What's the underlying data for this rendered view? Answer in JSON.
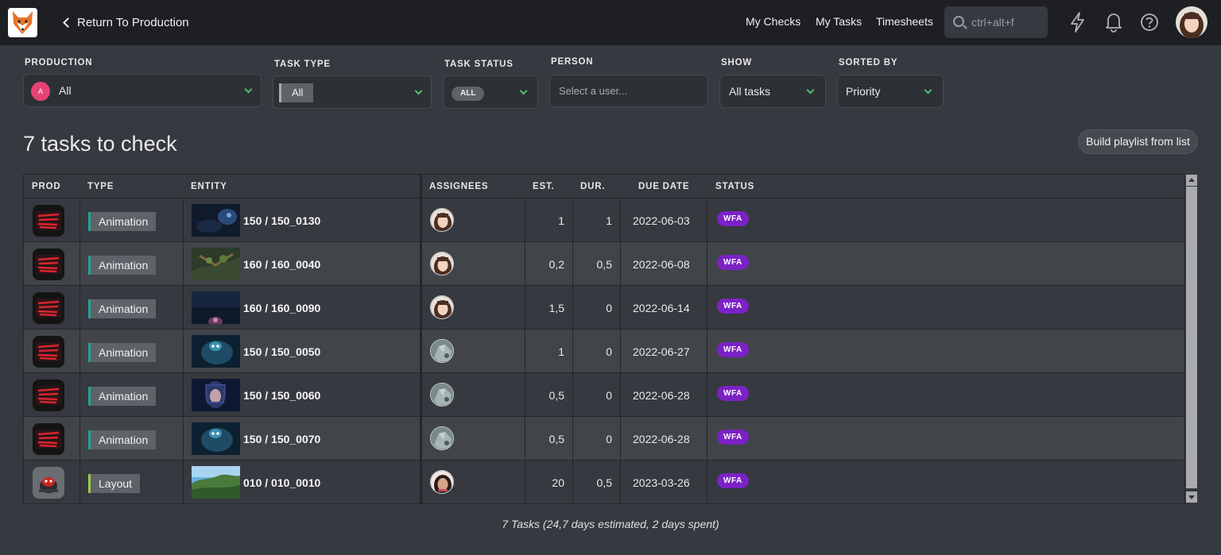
{
  "topbar": {
    "back_label": "Return To Production",
    "nav": [
      "My Checks",
      "My Tasks",
      "Timesheets"
    ],
    "search_placeholder": "ctrl+alt+f"
  },
  "filters": {
    "production": {
      "label": "PRODUCTION",
      "initial": "A",
      "value": "All"
    },
    "task_type": {
      "label": "TASK TYPE",
      "value": "All"
    },
    "task_status": {
      "label": "TASK STATUS",
      "value": "ALL"
    },
    "person": {
      "label": "PERSON",
      "placeholder": "Select a user..."
    },
    "show": {
      "label": "SHOW",
      "value": "All tasks"
    },
    "sorted_by": {
      "label": "SORTED BY",
      "value": "Priority"
    }
  },
  "heading": "7 tasks to check",
  "playlist_button": "Build playlist from list",
  "table": {
    "columns": [
      "PROD",
      "TYPE",
      "ENTITY",
      "ASSIGNEES",
      "EST.",
      "DUR.",
      "DUE DATE",
      "STATUS"
    ],
    "rows": [
      {
        "prod": "sprite-fright",
        "type": "Animation",
        "entity": "150 / 150_0130",
        "thumb": "dark-blue",
        "assignee": "woman-a",
        "est": "1",
        "dur": "1",
        "due": "2022-06-03",
        "status": "WFA"
      },
      {
        "prod": "sprite-fright",
        "type": "Animation",
        "entity": "160 / 160_0040",
        "thumb": "forest",
        "assignee": "woman-a",
        "est": "0,2",
        "dur": "0,5",
        "due": "2022-06-08",
        "status": "WFA"
      },
      {
        "prod": "sprite-fright",
        "type": "Animation",
        "entity": "160 / 160_0090",
        "thumb": "night",
        "assignee": "woman-a",
        "est": "1,5",
        "dur": "0",
        "due": "2022-06-14",
        "status": "WFA"
      },
      {
        "prod": "sprite-fright",
        "type": "Animation",
        "entity": "150 / 150_0050",
        "thumb": "blue-creature",
        "assignee": "rock",
        "est": "1",
        "dur": "0",
        "due": "2022-06-27",
        "status": "WFA"
      },
      {
        "prod": "sprite-fright",
        "type": "Animation",
        "entity": "150 / 150_0060",
        "thumb": "blue-hair",
        "assignee": "rock",
        "est": "0,5",
        "dur": "0",
        "due": "2022-06-28",
        "status": "WFA"
      },
      {
        "prod": "sprite-fright",
        "type": "Animation",
        "entity": "150 / 150_0070",
        "thumb": "blue-creature",
        "assignee": "rock",
        "est": "0,5",
        "dur": "0",
        "due": "2022-06-28",
        "status": "WFA"
      },
      {
        "prod": "ladybug",
        "type": "Layout",
        "entity": "010 / 010_0010",
        "thumb": "landscape",
        "assignee": "woman-b",
        "est": "20",
        "dur": "0,5",
        "due": "2023-03-26",
        "status": "WFA"
      }
    ]
  },
  "footer": "7 Tasks (24,7 days estimated, 2 days spent)",
  "colors": {
    "status_wfa": "#7b22c6",
    "animation": "#1fa398",
    "layout": "#9acd4e",
    "accent": "#4fbc75"
  }
}
